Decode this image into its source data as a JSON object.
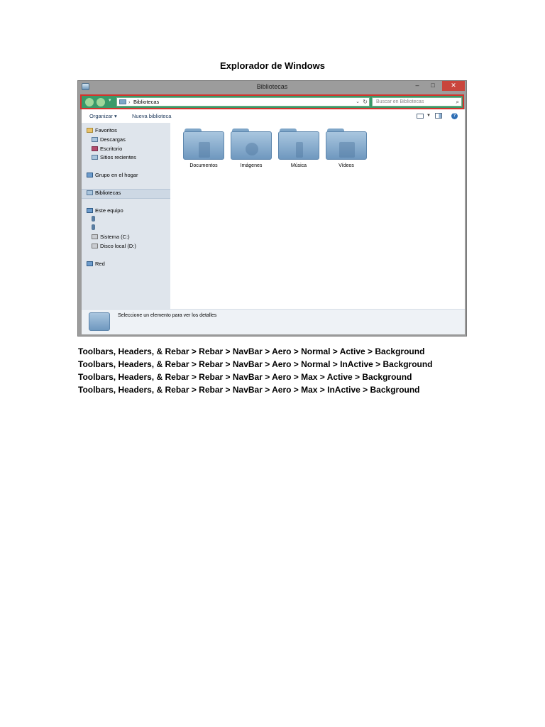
{
  "document": {
    "title": "Explorador de Windows",
    "captions": [
      "Toolbars, Headers, & Rebar > Rebar > NavBar > Aero > Normal > Active > Background",
      "Toolbars, Headers, & Rebar > Rebar > NavBar > Aero > Normal > InActive > Background",
      "Toolbars, Headers, & Rebar > Rebar > NavBar > Aero > Max > Active > Background",
      "Toolbars, Headers, & Rebar > Rebar > NavBar > Aero > Max > InActive > Background"
    ]
  },
  "window": {
    "title": "Bibliotecas",
    "buttons": {
      "minimize": "–",
      "maximize": "□",
      "close": "✕"
    },
    "navbar": {
      "address": "Bibliotecas",
      "search_placeholder": "Buscar en Bibliotecas",
      "accent_color": "#3a9a6a",
      "highlight_color": "#d4322c"
    },
    "toolbar": {
      "organize": "Organizar ▾",
      "new_library": "Nueva biblioteca",
      "help": "?"
    },
    "sidebar": {
      "items": [
        "Favoritos",
        "Descargas",
        "Escritorio",
        "Sitios recientes",
        "Grupo en el hogar",
        "Bibliotecas",
        "Este equipo",
        "Sistema (C:)",
        "Disco local (D:)",
        "Red"
      ]
    },
    "folders": [
      "Documentos",
      "Imágenes",
      "Música",
      "Vídeos"
    ],
    "details_text": "Seleccione un elemento para ver los detalles"
  }
}
